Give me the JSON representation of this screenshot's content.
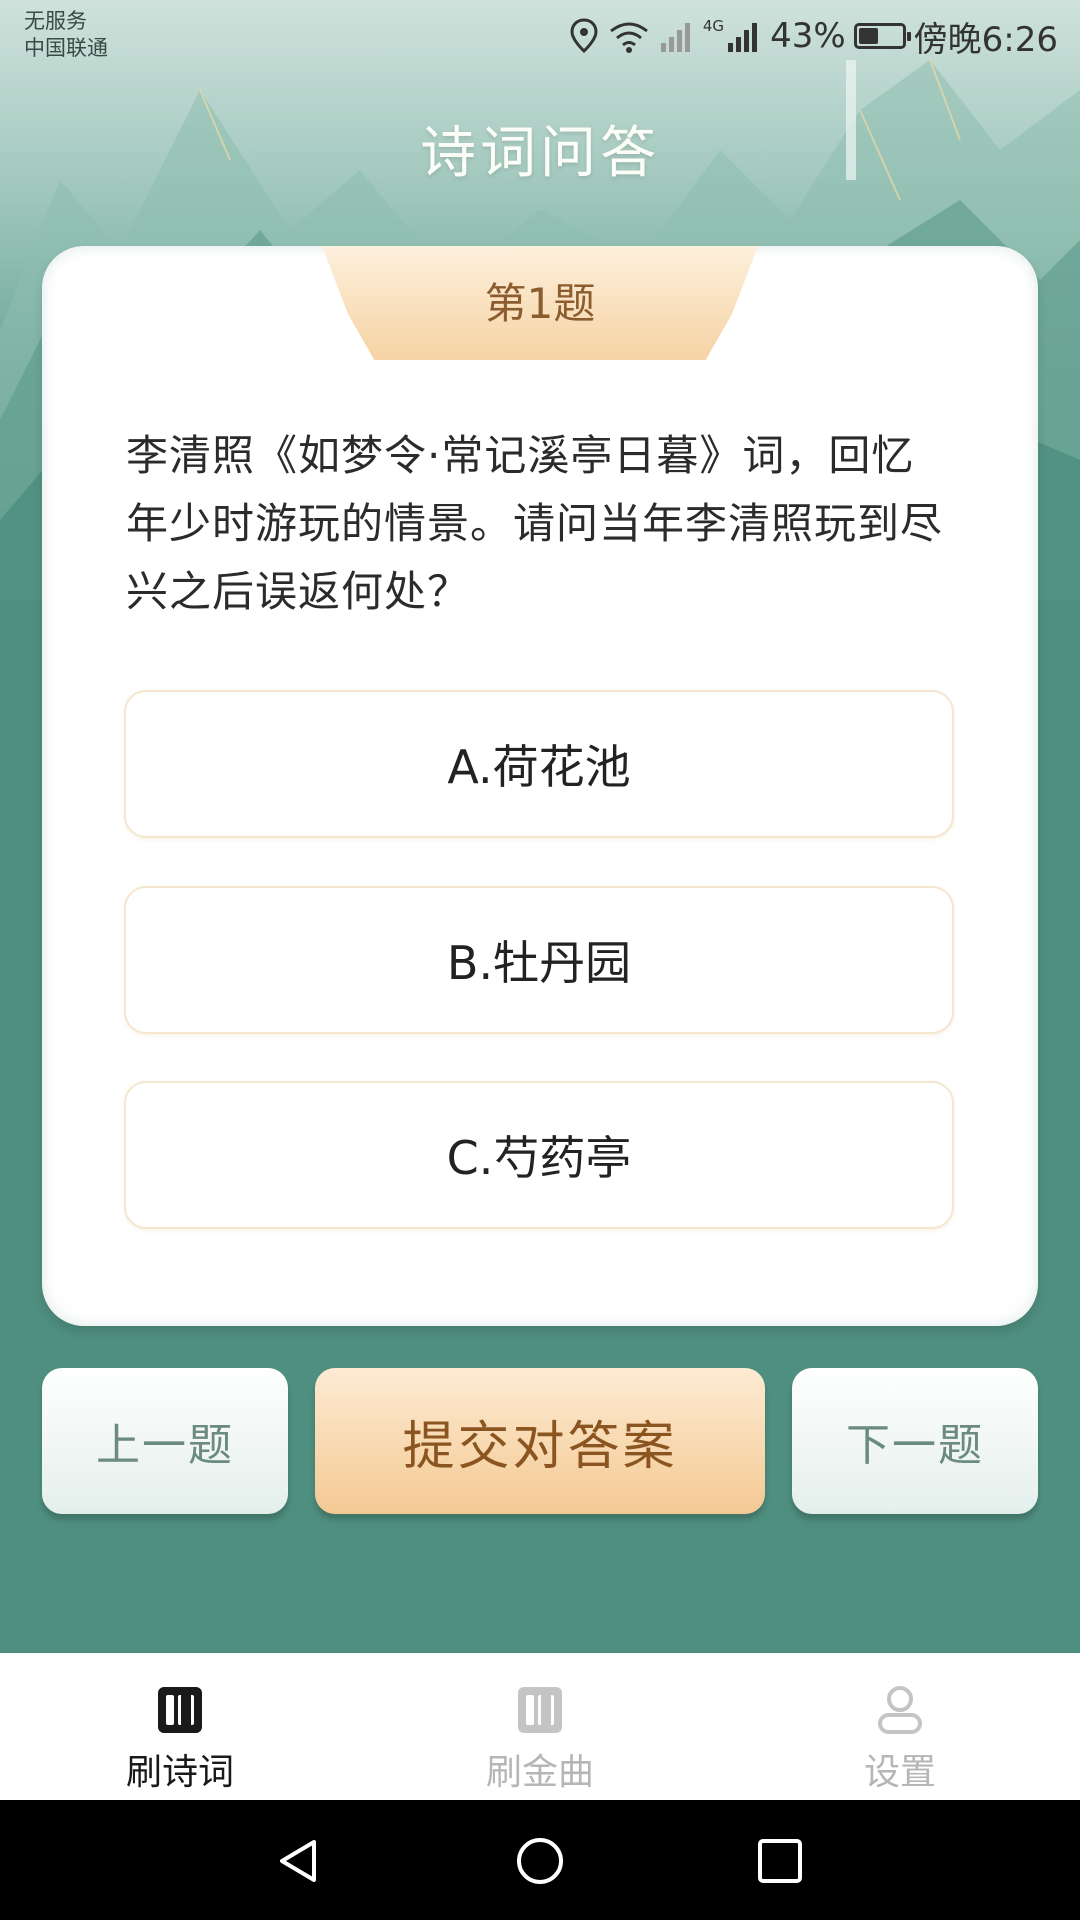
{
  "status_bar": {
    "carrier_line1": "无服务",
    "carrier_line2": "中国联通",
    "network": "4G",
    "battery": "43%",
    "battery_level": 0.43,
    "time": "傍晚6:26"
  },
  "header": {
    "title": "诗词问答"
  },
  "quiz": {
    "number_label": "第1题",
    "question": "李清照《如梦令·常记溪亭日暮》词，回忆年少时游玩的情景。请问当年李清照玩到尽兴之后误返何处？",
    "options": [
      {
        "label": "A.荷花池"
      },
      {
        "label": "B.牡丹园"
      },
      {
        "label": "C.芍药亭"
      }
    ]
  },
  "actions": {
    "prev_label": "上一题",
    "submit_label": "提交对答案",
    "next_label": "下一题"
  },
  "tabbar": {
    "items": [
      {
        "label": "刷诗词",
        "icon": "book-icon",
        "active": true
      },
      {
        "label": "刷金曲",
        "icon": "book-icon",
        "active": false
      },
      {
        "label": "设置",
        "icon": "person-icon",
        "active": false
      }
    ]
  },
  "system_nav": {
    "icons": [
      "back-icon",
      "home-icon",
      "recents-icon"
    ]
  },
  "colors": {
    "theme_green": "#4f8f7f",
    "accent_gold": "#f4c993",
    "submit_text": "#8b5521"
  }
}
